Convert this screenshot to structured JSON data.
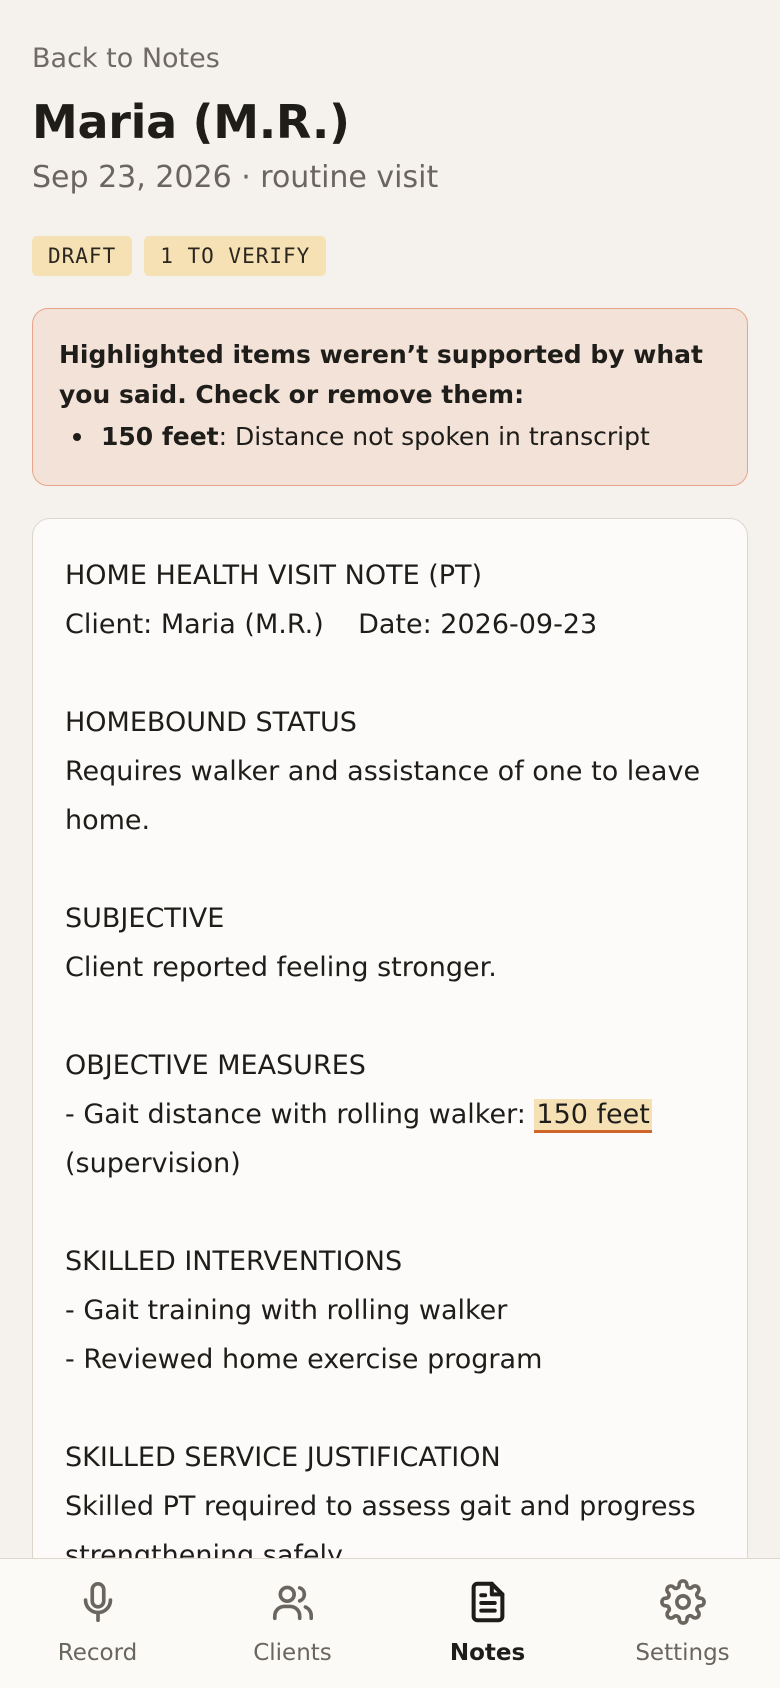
{
  "header": {
    "back_label": "Back to Notes",
    "title": "Maria (M.R.)",
    "subtitle": "Sep 23, 2026 · routine visit"
  },
  "badges": [
    "DRAFT",
    "1 TO VERIFY"
  ],
  "alert": {
    "heading": "Highlighted items weren’t supported by what you said. Check or remove them:",
    "items": [
      {
        "term": "150 feet",
        "detail": ": Distance not spoken in transcript"
      }
    ]
  },
  "note": {
    "header_title": "HOME HEALTH VISIT NOTE (PT)",
    "client_line": "Client: Maria (M.R.)    Date: 2026-09-23",
    "homebound_heading": "HOMEBOUND STATUS",
    "homebound_text": "Requires walker and assistance of one to leave home.",
    "subjective_heading": "SUBJECTIVE",
    "subjective_text": "Client reported feeling stronger.",
    "objective_heading": "OBJECTIVE MEASURES",
    "objective_prefix": "- Gait distance with rolling walker: ",
    "objective_highlight": "150 feet",
    "objective_suffix": " (supervision)",
    "interventions_heading": "SKILLED INTERVENTIONS",
    "intervention_1": "- Gait training with rolling walker",
    "intervention_2": "- Reviewed home exercise program",
    "justification_heading": "SKILLED SERVICE JUSTIFICATION",
    "justification_text": "Skilled PT required to assess gait and progress strengthening safely."
  },
  "nav": {
    "items": [
      {
        "label": "Record",
        "icon": "microphone-icon"
      },
      {
        "label": "Clients",
        "icon": "users-icon"
      },
      {
        "label": "Notes",
        "icon": "document-icon",
        "active": true
      },
      {
        "label": "Settings",
        "icon": "gear-icon"
      }
    ]
  },
  "colors": {
    "background": "#f5f2ed",
    "badge_bg": "#f5e1b4",
    "alert_bg": "#f3e2d8",
    "alert_border": "#e8a48a",
    "highlight_underline": "#d0662c"
  }
}
